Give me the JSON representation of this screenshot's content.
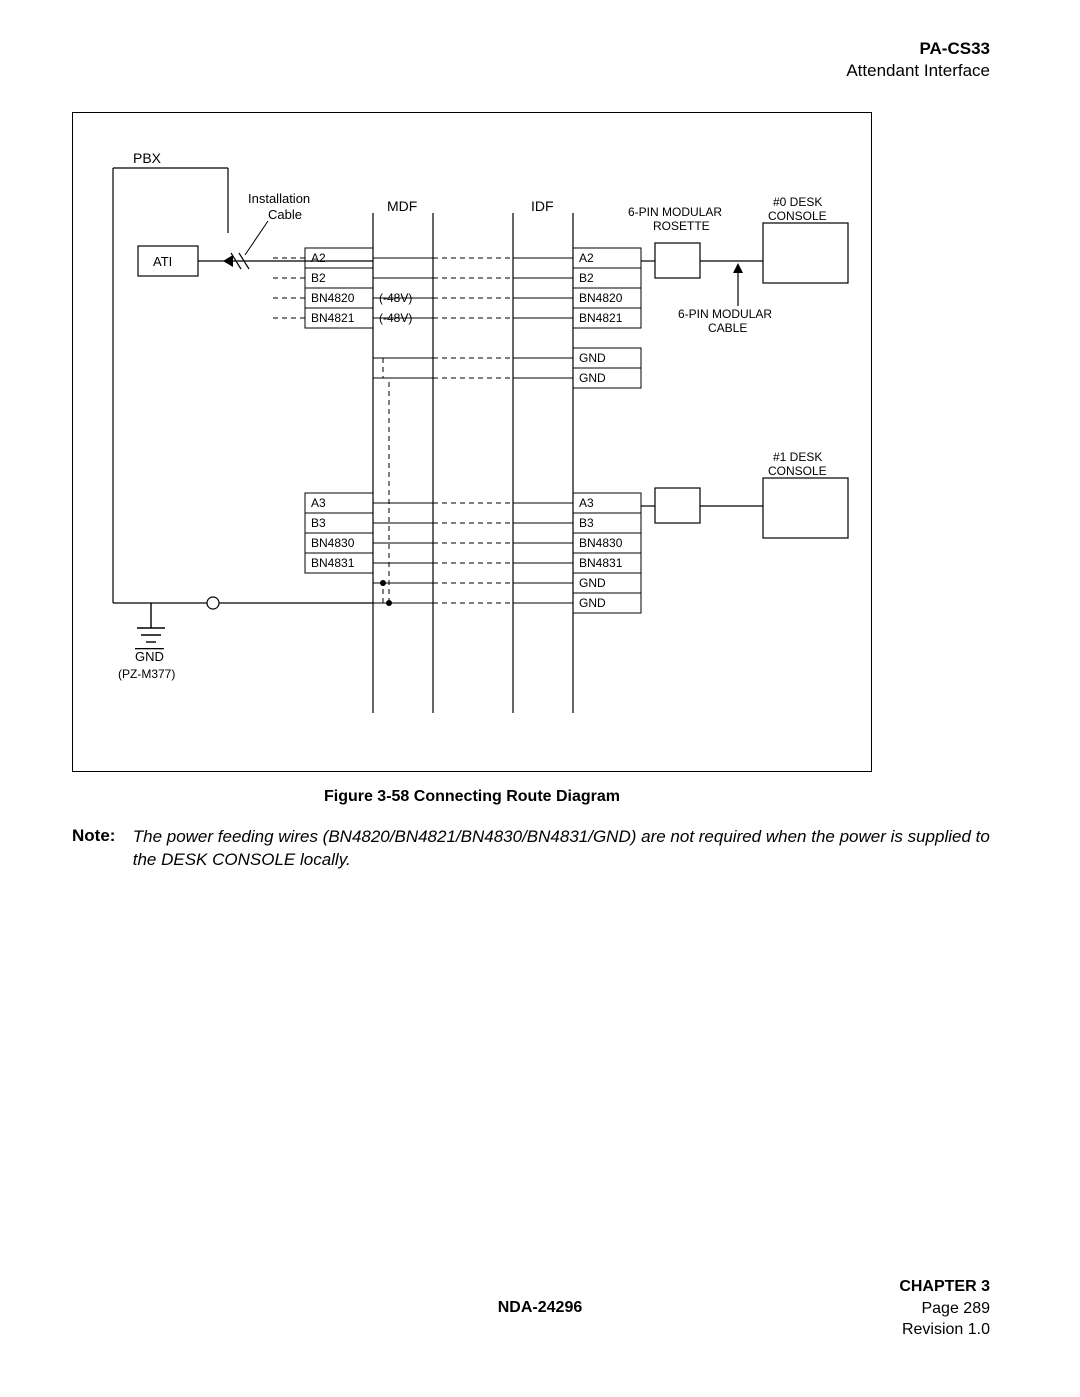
{
  "header": {
    "code": "PA-CS33",
    "sub": "Attendant Interface"
  },
  "figure": {
    "caption": "Figure 3-58   Connecting Route Diagram"
  },
  "note": {
    "label": "Note:",
    "text": "The power feeding wires (BN4820/BN4821/BN4830/BN4831/GND) are not required when the power is supplied to the DESK CONSOLE locally."
  },
  "footer": {
    "doc": "NDA-24296",
    "chapter": "CHAPTER 3",
    "page": "Page 289",
    "rev": "Revision 1.0"
  },
  "diagram": {
    "labels": {
      "pbx": "PBX",
      "ati": "ATI",
      "installCable": "Installation\nCable",
      "mdf": "MDF",
      "idf": "IDF",
      "rosette": "6-PIN MODULAR\nROSETTE",
      "modCable": "6-PIN MODULAR\nCABLE",
      "console0": "#0 DESK\nCONSOLE",
      "console1": "#1 DESK\nCONSOLE",
      "gndTop": "GND",
      "pzm": "(PZ-M377)"
    },
    "block0": {
      "left": [
        "A2",
        "B2",
        "BN4820",
        "BN4821"
      ],
      "right": [
        "A2",
        "B2",
        "BN4820",
        "BN4821"
      ],
      "v48": [
        "(-48V)",
        "(-48V)"
      ],
      "gnd": [
        "GND",
        "GND"
      ]
    },
    "block1": {
      "left": [
        "A3",
        "B3",
        "BN4830",
        "BN4831"
      ],
      "right": [
        "A3",
        "B3",
        "BN4830",
        "BN4831"
      ],
      "gnd": [
        "GND",
        "GND"
      ]
    }
  }
}
